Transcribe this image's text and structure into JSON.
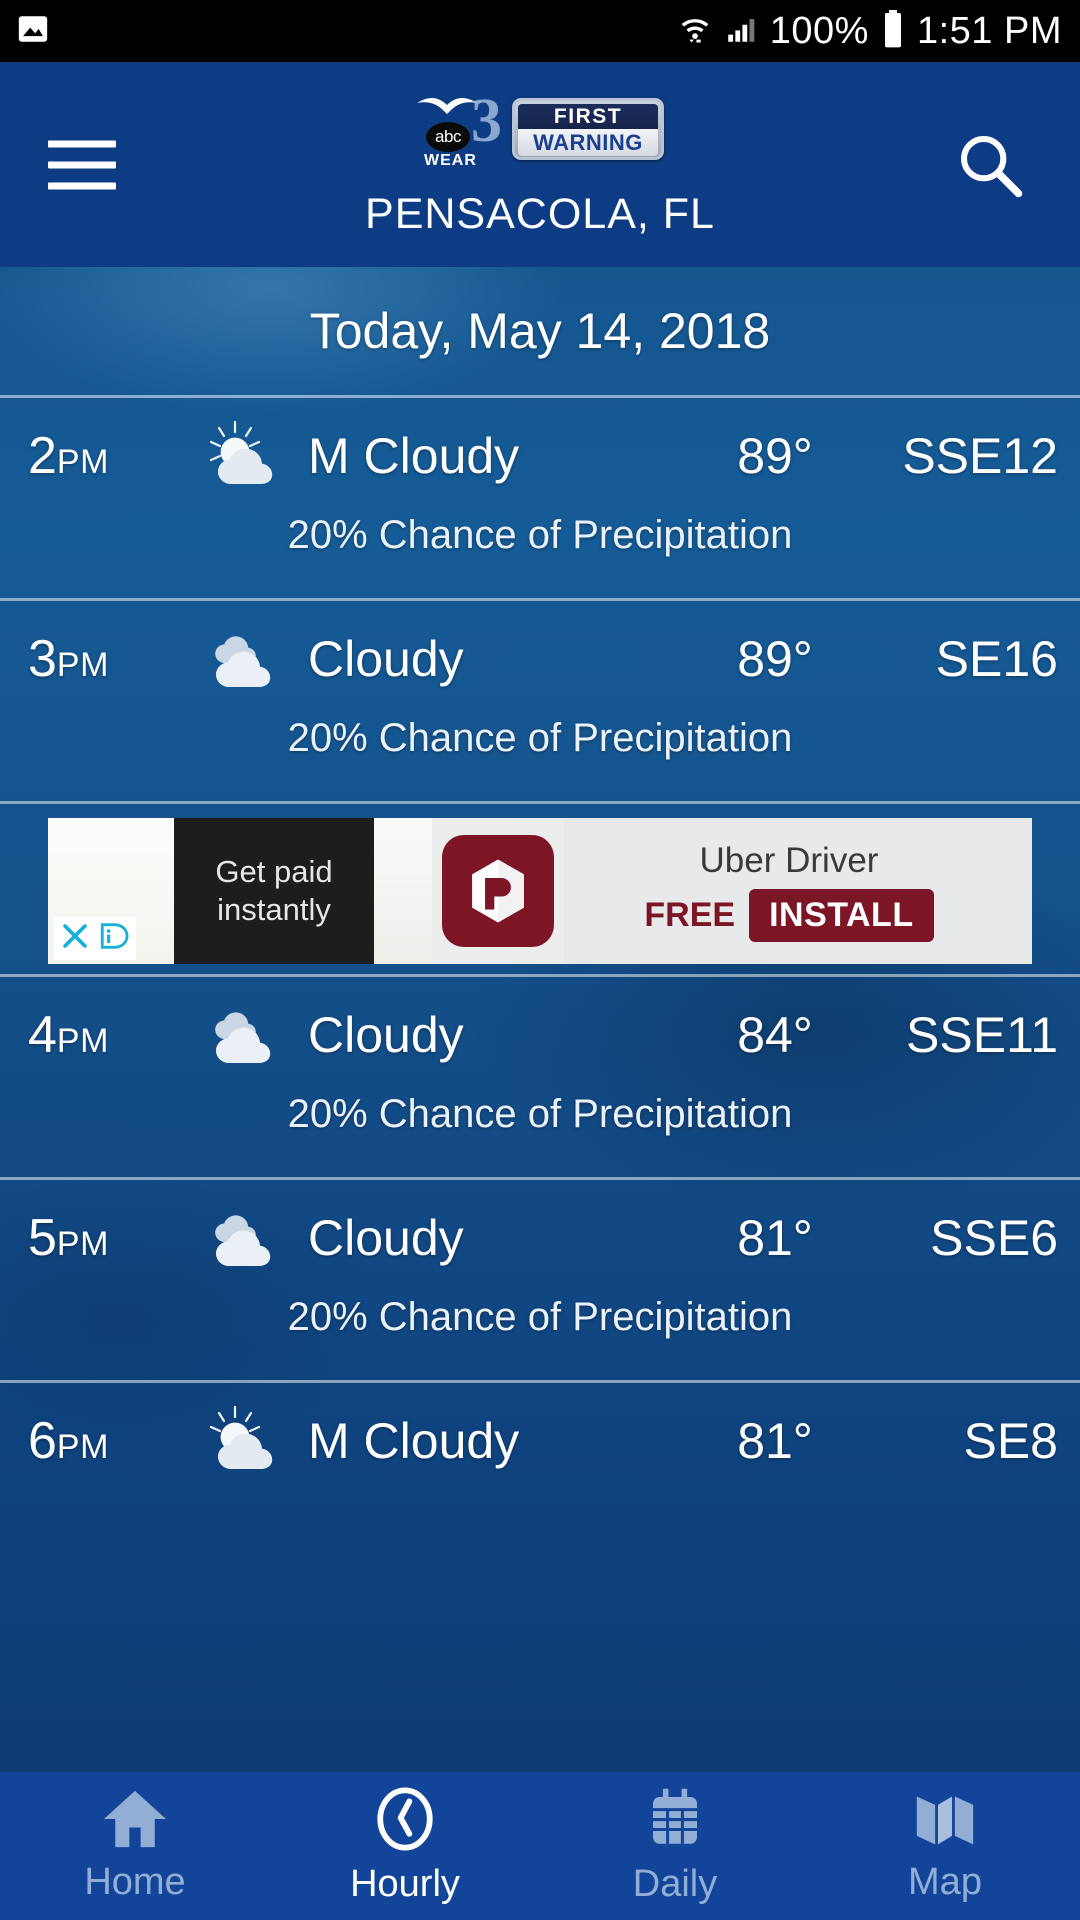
{
  "status_bar": {
    "left_icon": "image-icon",
    "wifi_icon": "wifi-icon",
    "signal_icon": "cellular-signal-icon",
    "battery_percent": "100%",
    "battery_icon": "battery-full-icon",
    "time": "1:51 PM"
  },
  "header": {
    "menu_icon": "hamburger-menu-icon",
    "search_icon": "search-icon",
    "logo": {
      "channel_number": "3",
      "network": "abc",
      "callsign": "WEAR",
      "badge_line1": "FIRST",
      "badge_line2": "WARNING"
    },
    "location": "PENSACOLA, FL",
    "bg_color": "#0d3c85"
  },
  "main": {
    "date_heading": "Today, May 14, 2018",
    "hours": [
      {
        "time_number": "2",
        "meridiem": "PM",
        "icon": "partly-cloudy-icon",
        "condition": "M Cloudy",
        "temperature": "89°",
        "wind": "SSE12",
        "precipitation": "20% Chance of Precipitation"
      },
      {
        "time_number": "3",
        "meridiem": "PM",
        "icon": "cloudy-icon",
        "condition": "Cloudy",
        "temperature": "89°",
        "wind": "SE16",
        "precipitation": "20% Chance of Precipitation"
      },
      {
        "time_number": "4",
        "meridiem": "PM",
        "icon": "cloudy-icon",
        "condition": "Cloudy",
        "temperature": "84°",
        "wind": "SSE11",
        "precipitation": "20% Chance of Precipitation"
      },
      {
        "time_number": "5",
        "meridiem": "PM",
        "icon": "cloudy-icon",
        "condition": "Cloudy",
        "temperature": "81°",
        "wind": "SSE6",
        "precipitation": "20% Chance of Precipitation"
      },
      {
        "time_number": "6",
        "meridiem": "PM",
        "icon": "partly-cloudy-icon",
        "condition": "M Cloudy",
        "temperature": "81°",
        "wind": "SE8",
        "precipitation": ""
      }
    ]
  },
  "ad": {
    "close_icon": "close-icon",
    "adchoices_icon": "adchoices-icon",
    "tagline": "Get paid\ninstantly",
    "tagline_line1": "Get paid",
    "tagline_line2": "instantly",
    "app_icon": "uber-driver-app-icon",
    "app_name": "Uber Driver",
    "price_label": "FREE",
    "install_label": "INSTALL",
    "accent_color": "#7c1526"
  },
  "bottom_nav": {
    "items": [
      {
        "label": "Home",
        "icon": "home-icon",
        "active": false
      },
      {
        "label": "Hourly",
        "icon": "clock-icon",
        "active": true
      },
      {
        "label": "Daily",
        "icon": "calendar-icon",
        "active": false
      },
      {
        "label": "Map",
        "icon": "map-icon",
        "active": false
      }
    ],
    "bg_color": "#12459a",
    "active_color": "#ffffff",
    "inactive_color": "#93aed4"
  }
}
